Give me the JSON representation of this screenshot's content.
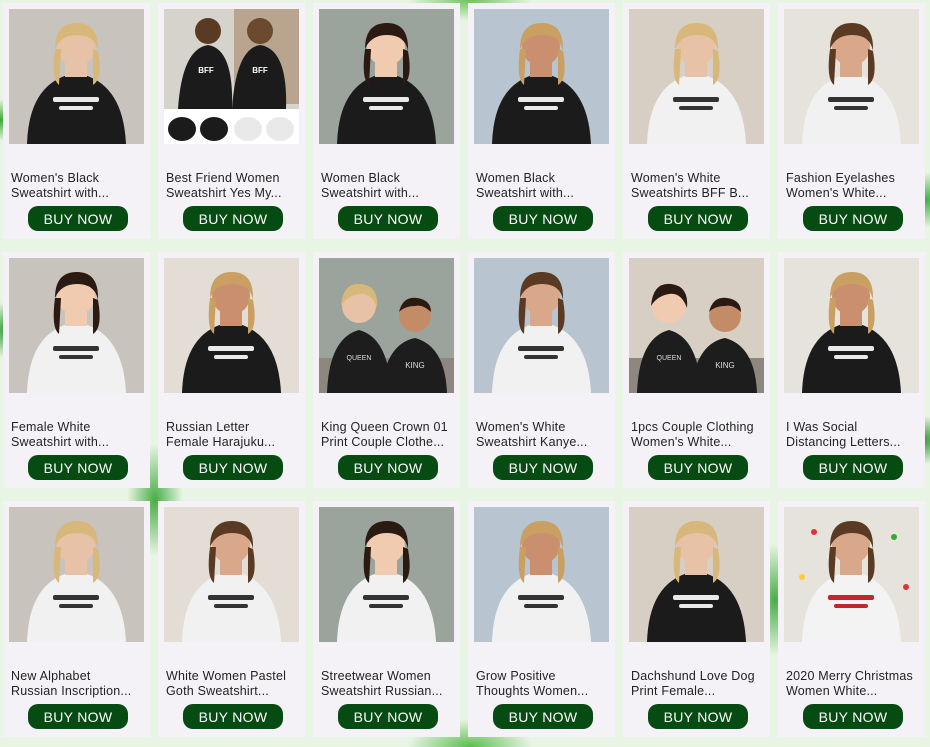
{
  "buy_label": "BUY NOW",
  "colors": {
    "button": "#064b12",
    "card": "#f4f2f7",
    "background": "#e9f5e4"
  },
  "products": [
    {
      "line1": "Women's Black",
      "line2": "Sweatshirt with...",
      "image": "black-sweatshirt-photo"
    },
    {
      "line1": "Best Friend Women",
      "line2": "Sweatshirt Yes My...",
      "image": "bff-sweatshirts-photo"
    },
    {
      "line1": "Women Black",
      "line2": "Sweatshirt with...",
      "image": "black-sweatshirt-photo"
    },
    {
      "line1": "Women Black",
      "line2": "Sweatshirt with...",
      "image": "black-sweatshirt-photo"
    },
    {
      "line1": "Women's White",
      "line2": "Sweatshirts BFF B...",
      "image": "white-sweatshirt-photo"
    },
    {
      "line1": "Fashion Eyelashes",
      "line2": "Women's White...",
      "image": "white-sweatshirt-photo"
    },
    {
      "line1": "Female White",
      "line2": "Sweatshirt with...",
      "image": "white-sweatshirt-photo"
    },
    {
      "line1": "Russian Letter",
      "line2": "Female Harajuku...",
      "image": "black-sweatshirt-photo"
    },
    {
      "line1": "King Queen Crown 01",
      "line2": "Print Couple Clothe...",
      "image": "couple-sweatshirts-photo"
    },
    {
      "line1": "Women's White",
      "line2": "Sweatshirt Kanye...",
      "image": "white-sweatshirt-photo"
    },
    {
      "line1": "1pcs Couple Clothing",
      "line2": "Women's White...",
      "image": "couple-sweatshirts-photo"
    },
    {
      "line1": "I Was Social",
      "line2": "Distancing Letters...",
      "image": "black-sweatshirt-photo"
    },
    {
      "line1": "New Alphabet",
      "line2": "Russian Inscription...",
      "image": "white-sweatshirt-photo"
    },
    {
      "line1": "White Women Pastel",
      "line2": "Goth Sweatshirt...",
      "image": "white-sweatshirt-photo"
    },
    {
      "line1": "Streetwear Women",
      "line2": "Sweatshirt Russian...",
      "image": "white-sweatshirt-photo"
    },
    {
      "line1": "Grow Positive",
      "line2": "Thoughts Women...",
      "image": "white-sweatshirt-photo"
    },
    {
      "line1": "Dachshund Love Dog",
      "line2": "Print Female...",
      "image": "black-sweatshirt-photo"
    },
    {
      "line1": "2020 Merry Christmas",
      "line2": "Women White...",
      "image": "christmas-sweatshirt-photo"
    }
  ]
}
